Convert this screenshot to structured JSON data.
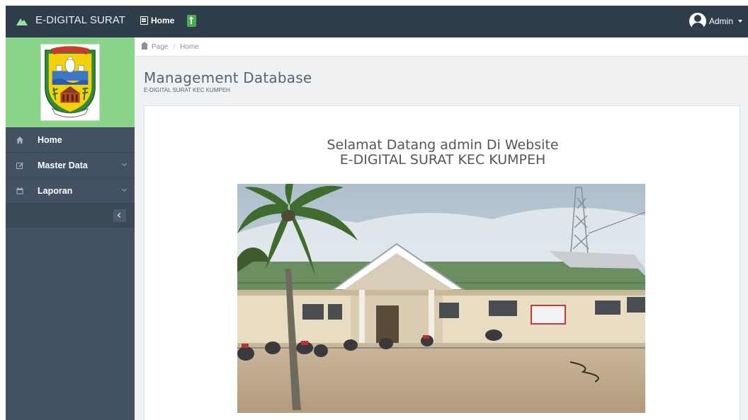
{
  "topbar": {
    "brand": "E-DIGITAL SURAT",
    "home_label": "Home",
    "user_label": "Admin"
  },
  "sidebar": {
    "items": [
      {
        "label": "Home",
        "icon": "home-icon",
        "has_submenu": false
      },
      {
        "label": "Master Data",
        "icon": "edit-icon",
        "has_submenu": true
      },
      {
        "label": "Laporan",
        "icon": "calendar-icon",
        "has_submenu": true
      }
    ]
  },
  "breadcrumb": {
    "items": [
      "Page",
      "Home"
    ]
  },
  "main": {
    "title": "Management Database",
    "subtitle": "E-DIGITAL SURAT KEC KUMPEH",
    "welcome_line1": "Selamat Datang admin Di Website",
    "welcome_line2": "E-DIGITAL SURAT KEC KUMPEH"
  },
  "colors": {
    "topbar": "#2f3d4b",
    "sidebar": "#435163",
    "logo_bg": "#8bd58a",
    "upload_button": "#4cae4c"
  }
}
